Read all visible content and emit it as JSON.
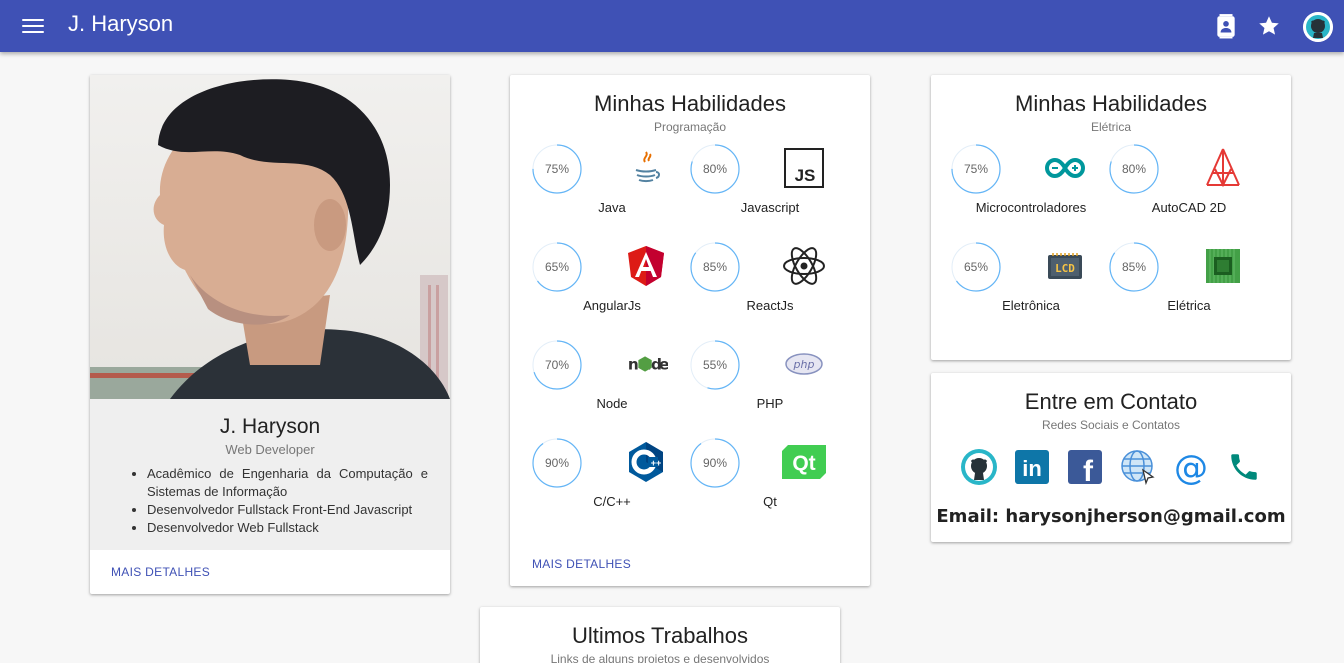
{
  "app": {
    "title": "J. Haryson"
  },
  "profile": {
    "name": "J. Haryson",
    "role": "Web Developer",
    "bullets": [
      "Acadêmico de Engenharia da Computação e Sistemas de Informação",
      "Desenvolvedor Fullstack Front-End Javascript",
      "Desenvolvedor Web Fullstack"
    ],
    "more_label": "MAIS DETALHES"
  },
  "programming": {
    "title": "Minhas Habilidades",
    "subtitle": "Programação",
    "more_label": "MAIS DETALHES",
    "skills": [
      {
        "name": "Java",
        "percent_label": "75%",
        "percent": 75,
        "icon": "java-icon"
      },
      {
        "name": "Javascript",
        "percent_label": "80%",
        "percent": 80,
        "icon": "javascript-icon"
      },
      {
        "name": "AngularJs",
        "percent_label": "65%",
        "percent": 65,
        "icon": "angular-icon"
      },
      {
        "name": "ReactJs",
        "percent_label": "85%",
        "percent": 85,
        "icon": "react-icon"
      },
      {
        "name": "Node",
        "percent_label": "70%",
        "percent": 70,
        "icon": "node-icon"
      },
      {
        "name": "PHP",
        "percent_label": "55%",
        "percent": 55,
        "icon": "php-icon"
      },
      {
        "name": "C/C++",
        "percent_label": "90%",
        "percent": 90,
        "icon": "cpp-icon"
      },
      {
        "name": "Qt",
        "percent_label": "90%",
        "percent": 90,
        "icon": "qt-icon"
      }
    ]
  },
  "electrical": {
    "title": "Minhas Habilidades",
    "subtitle": "Elétrica",
    "skills": [
      {
        "name": "Microcontroladores",
        "percent_label": "75%",
        "percent": 75,
        "icon": "arduino-icon"
      },
      {
        "name": "AutoCAD 2D",
        "percent_label": "80%",
        "percent": 80,
        "icon": "autocad-icon"
      },
      {
        "name": "Eletrônica",
        "percent_label": "65%",
        "percent": 65,
        "icon": "lcd-icon"
      },
      {
        "name": "Elétrica",
        "percent_label": "85%",
        "percent": 85,
        "icon": "chip-icon"
      }
    ]
  },
  "contact": {
    "title": "Entre em Contato",
    "subtitle": "Redes Sociais e Contatos",
    "email": "Email: harysonjherson@gmail.com",
    "icons": [
      "github-icon",
      "linkedin-icon",
      "facebook-icon",
      "website-icon",
      "email-icon",
      "phone-icon"
    ],
    "lcd_text": "LCD",
    "linkedin_text": "in",
    "facebook_text": "f",
    "at_text": "@"
  },
  "works": {
    "title": "Ultimos Trabalhos",
    "subtitle": "Links de alguns projetos e desenvolvidos"
  },
  "colors": {
    "primary": "#3f51b5",
    "ring": "#64b5f6",
    "ring_track": "#e3eef8"
  }
}
